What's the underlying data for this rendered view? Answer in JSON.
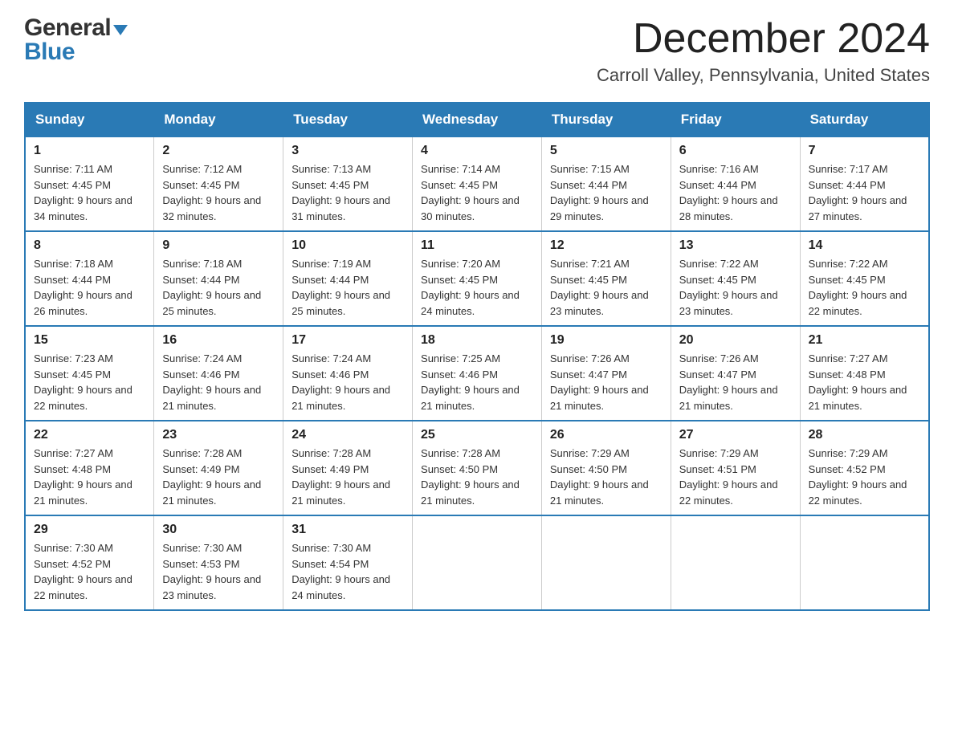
{
  "header": {
    "logo_general": "General",
    "logo_blue": "Blue",
    "month_title": "December 2024",
    "location": "Carroll Valley, Pennsylvania, United States"
  },
  "weekdays": [
    "Sunday",
    "Monday",
    "Tuesday",
    "Wednesday",
    "Thursday",
    "Friday",
    "Saturday"
  ],
  "weeks": [
    [
      {
        "day": "1",
        "sunrise": "Sunrise: 7:11 AM",
        "sunset": "Sunset: 4:45 PM",
        "daylight": "Daylight: 9 hours and 34 minutes."
      },
      {
        "day": "2",
        "sunrise": "Sunrise: 7:12 AM",
        "sunset": "Sunset: 4:45 PM",
        "daylight": "Daylight: 9 hours and 32 minutes."
      },
      {
        "day": "3",
        "sunrise": "Sunrise: 7:13 AM",
        "sunset": "Sunset: 4:45 PM",
        "daylight": "Daylight: 9 hours and 31 minutes."
      },
      {
        "day": "4",
        "sunrise": "Sunrise: 7:14 AM",
        "sunset": "Sunset: 4:45 PM",
        "daylight": "Daylight: 9 hours and 30 minutes."
      },
      {
        "day": "5",
        "sunrise": "Sunrise: 7:15 AM",
        "sunset": "Sunset: 4:44 PM",
        "daylight": "Daylight: 9 hours and 29 minutes."
      },
      {
        "day": "6",
        "sunrise": "Sunrise: 7:16 AM",
        "sunset": "Sunset: 4:44 PM",
        "daylight": "Daylight: 9 hours and 28 minutes."
      },
      {
        "day": "7",
        "sunrise": "Sunrise: 7:17 AM",
        "sunset": "Sunset: 4:44 PM",
        "daylight": "Daylight: 9 hours and 27 minutes."
      }
    ],
    [
      {
        "day": "8",
        "sunrise": "Sunrise: 7:18 AM",
        "sunset": "Sunset: 4:44 PM",
        "daylight": "Daylight: 9 hours and 26 minutes."
      },
      {
        "day": "9",
        "sunrise": "Sunrise: 7:18 AM",
        "sunset": "Sunset: 4:44 PM",
        "daylight": "Daylight: 9 hours and 25 minutes."
      },
      {
        "day": "10",
        "sunrise": "Sunrise: 7:19 AM",
        "sunset": "Sunset: 4:44 PM",
        "daylight": "Daylight: 9 hours and 25 minutes."
      },
      {
        "day": "11",
        "sunrise": "Sunrise: 7:20 AM",
        "sunset": "Sunset: 4:45 PM",
        "daylight": "Daylight: 9 hours and 24 minutes."
      },
      {
        "day": "12",
        "sunrise": "Sunrise: 7:21 AM",
        "sunset": "Sunset: 4:45 PM",
        "daylight": "Daylight: 9 hours and 23 minutes."
      },
      {
        "day": "13",
        "sunrise": "Sunrise: 7:22 AM",
        "sunset": "Sunset: 4:45 PM",
        "daylight": "Daylight: 9 hours and 23 minutes."
      },
      {
        "day": "14",
        "sunrise": "Sunrise: 7:22 AM",
        "sunset": "Sunset: 4:45 PM",
        "daylight": "Daylight: 9 hours and 22 minutes."
      }
    ],
    [
      {
        "day": "15",
        "sunrise": "Sunrise: 7:23 AM",
        "sunset": "Sunset: 4:45 PM",
        "daylight": "Daylight: 9 hours and 22 minutes."
      },
      {
        "day": "16",
        "sunrise": "Sunrise: 7:24 AM",
        "sunset": "Sunset: 4:46 PM",
        "daylight": "Daylight: 9 hours and 21 minutes."
      },
      {
        "day": "17",
        "sunrise": "Sunrise: 7:24 AM",
        "sunset": "Sunset: 4:46 PM",
        "daylight": "Daylight: 9 hours and 21 minutes."
      },
      {
        "day": "18",
        "sunrise": "Sunrise: 7:25 AM",
        "sunset": "Sunset: 4:46 PM",
        "daylight": "Daylight: 9 hours and 21 minutes."
      },
      {
        "day": "19",
        "sunrise": "Sunrise: 7:26 AM",
        "sunset": "Sunset: 4:47 PM",
        "daylight": "Daylight: 9 hours and 21 minutes."
      },
      {
        "day": "20",
        "sunrise": "Sunrise: 7:26 AM",
        "sunset": "Sunset: 4:47 PM",
        "daylight": "Daylight: 9 hours and 21 minutes."
      },
      {
        "day": "21",
        "sunrise": "Sunrise: 7:27 AM",
        "sunset": "Sunset: 4:48 PM",
        "daylight": "Daylight: 9 hours and 21 minutes."
      }
    ],
    [
      {
        "day": "22",
        "sunrise": "Sunrise: 7:27 AM",
        "sunset": "Sunset: 4:48 PM",
        "daylight": "Daylight: 9 hours and 21 minutes."
      },
      {
        "day": "23",
        "sunrise": "Sunrise: 7:28 AM",
        "sunset": "Sunset: 4:49 PM",
        "daylight": "Daylight: 9 hours and 21 minutes."
      },
      {
        "day": "24",
        "sunrise": "Sunrise: 7:28 AM",
        "sunset": "Sunset: 4:49 PM",
        "daylight": "Daylight: 9 hours and 21 minutes."
      },
      {
        "day": "25",
        "sunrise": "Sunrise: 7:28 AM",
        "sunset": "Sunset: 4:50 PM",
        "daylight": "Daylight: 9 hours and 21 minutes."
      },
      {
        "day": "26",
        "sunrise": "Sunrise: 7:29 AM",
        "sunset": "Sunset: 4:50 PM",
        "daylight": "Daylight: 9 hours and 21 minutes."
      },
      {
        "day": "27",
        "sunrise": "Sunrise: 7:29 AM",
        "sunset": "Sunset: 4:51 PM",
        "daylight": "Daylight: 9 hours and 22 minutes."
      },
      {
        "day": "28",
        "sunrise": "Sunrise: 7:29 AM",
        "sunset": "Sunset: 4:52 PM",
        "daylight": "Daylight: 9 hours and 22 minutes."
      }
    ],
    [
      {
        "day": "29",
        "sunrise": "Sunrise: 7:30 AM",
        "sunset": "Sunset: 4:52 PM",
        "daylight": "Daylight: 9 hours and 22 minutes."
      },
      {
        "day": "30",
        "sunrise": "Sunrise: 7:30 AM",
        "sunset": "Sunset: 4:53 PM",
        "daylight": "Daylight: 9 hours and 23 minutes."
      },
      {
        "day": "31",
        "sunrise": "Sunrise: 7:30 AM",
        "sunset": "Sunset: 4:54 PM",
        "daylight": "Daylight: 9 hours and 24 minutes."
      },
      null,
      null,
      null,
      null
    ]
  ]
}
